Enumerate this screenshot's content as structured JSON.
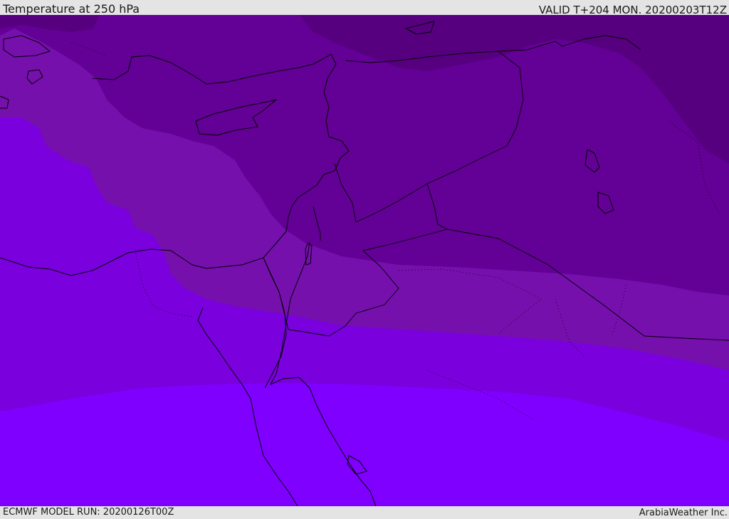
{
  "header": {
    "title": "Temperature at 250 hPa",
    "valid": "VALID T+204 MON. 20200203T12Z"
  },
  "footer": {
    "model_run": "ECMWF MODEL RUN: 20200126T00Z",
    "credit": "ArabiaWeather Inc."
  },
  "map": {
    "region": "Eastern Mediterranean, Levant, Sinai, northern Red Sea",
    "field": "Temperature at 250 hPa",
    "bands": [
      {
        "name": "band-darkest",
        "color": "#560080"
      },
      {
        "name": "band-dark",
        "color": "#630095"
      },
      {
        "name": "band-mid",
        "color": "#7510ad"
      },
      {
        "name": "band-light",
        "color": "#7a00dd"
      },
      {
        "name": "band-lightest",
        "color": "#7f00ff"
      }
    ],
    "coastline_color": "#000000"
  }
}
